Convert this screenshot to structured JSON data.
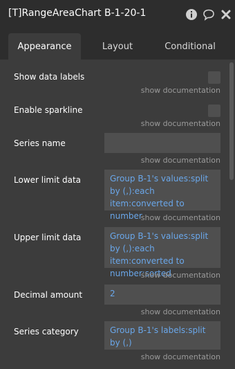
{
  "window": {
    "title": "[T]RangeAreaChart B-1-20-1",
    "icons": [
      "info-icon",
      "comment-icon",
      "close-icon"
    ]
  },
  "tabs": [
    {
      "label": "Appearance",
      "active": true
    },
    {
      "label": "Layout",
      "active": false
    },
    {
      "label": "Conditional",
      "active": false
    }
  ],
  "doc_link": "show documentation",
  "properties": {
    "show_data_labels": {
      "label": "Show data labels",
      "checked": false
    },
    "enable_sparkline": {
      "label": "Enable sparkline",
      "checked": false
    },
    "series_name": {
      "label": "Series name",
      "value": ""
    },
    "lower_limit_data": {
      "label": "Lower limit data",
      "value": "Group B-1's values:split by (,):each item:converted to number"
    },
    "upper_limit_data": {
      "label": "Upper limit data",
      "value": "Group B-1's values:split by (,):each item:converted to number:sorted"
    },
    "decimal_amount": {
      "label": "Decimal amount",
      "value": "2"
    },
    "series_category": {
      "label": "Series category",
      "value": "Group B-1's labels:split by (,)"
    }
  },
  "colors": {
    "panel_bg": "#3c3c3c",
    "header_bg": "#2d2d2d",
    "field_bg": "#4f4f4f",
    "dynamic_text": "#6aa7ea",
    "doc_link": "#9a9a9a"
  }
}
